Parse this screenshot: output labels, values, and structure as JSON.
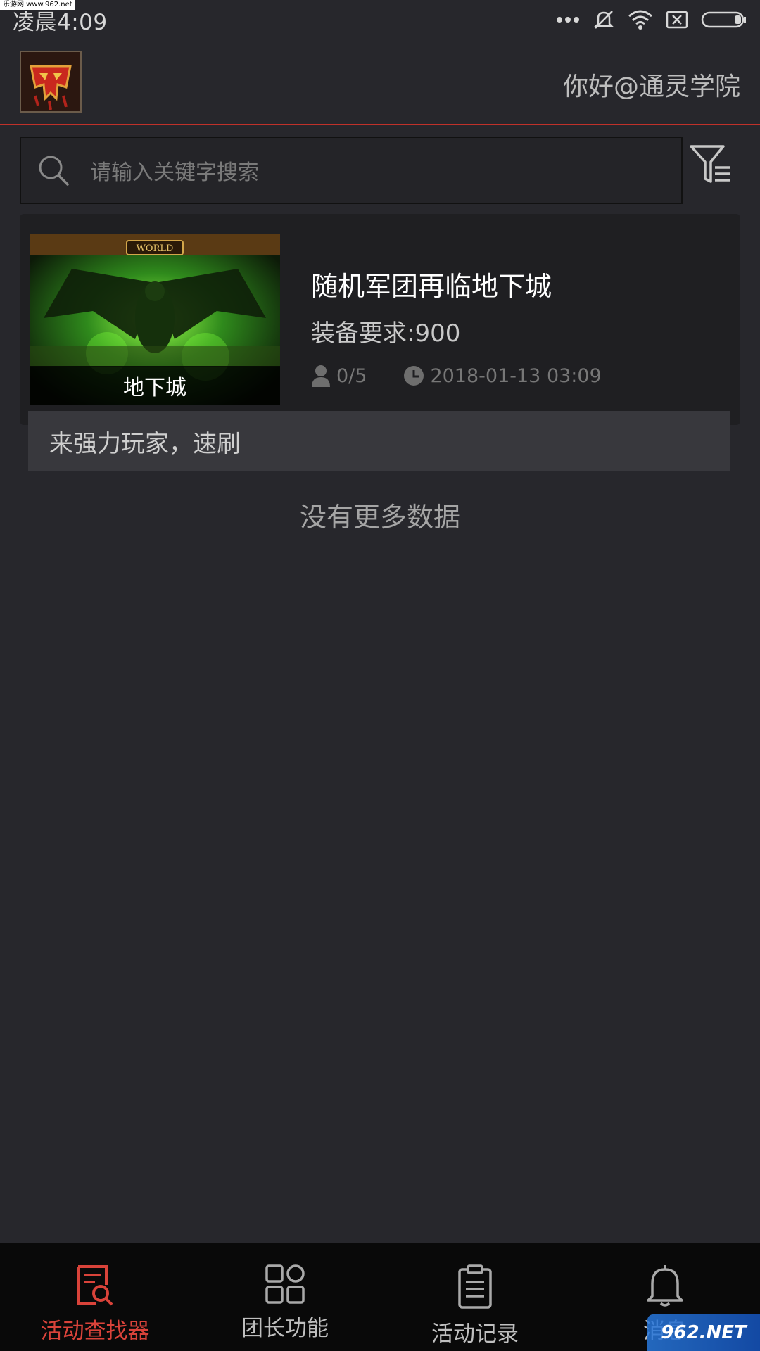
{
  "status_bar": {
    "time": "凌晨4:09",
    "watermark_tag": "乐游网 www.962.net"
  },
  "header": {
    "greeting": "你好@通灵学院",
    "logo_icon": "horde-logo-icon"
  },
  "search": {
    "placeholder": "请输入关键字搜索"
  },
  "activity": {
    "category_label": "地下城",
    "thumbnail_text": "WORLD",
    "title": "随机军团再临地下城",
    "requirement": "装备要求:900",
    "members": "0/5",
    "datetime": "2018-01-13 03:09",
    "description": "来强力玩家，速刷"
  },
  "list_end_text": "没有更多数据",
  "tabbar": {
    "tabs": [
      {
        "label": "活动查找器",
        "icon": "search-list-icon",
        "active": true
      },
      {
        "label": "团长功能",
        "icon": "grid-icon",
        "active": false
      },
      {
        "label": "活动记录",
        "icon": "clipboard-icon",
        "active": false
      },
      {
        "label": "消息",
        "icon": "bell-icon",
        "active": false
      }
    ]
  },
  "watermark": "962.NET",
  "colors": {
    "accent": "#d9433a",
    "background": "#27272c",
    "tabbar": "#090909"
  }
}
